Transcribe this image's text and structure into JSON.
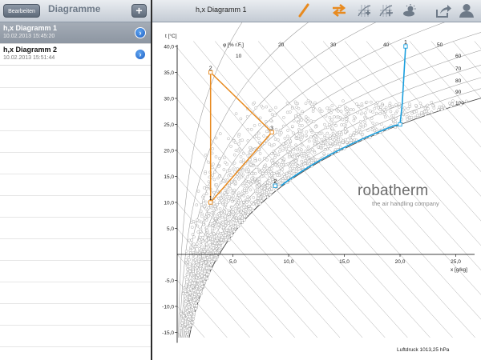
{
  "master": {
    "edit_label": "Bearbeiten",
    "title": "Diagramme",
    "add_label": "+",
    "items": [
      {
        "name": "h,x Diagramm 1",
        "date": "10.02.2013 15:45:20",
        "selected": true
      },
      {
        "name": "h,x Diagramm 2",
        "date": "10.02.2013 15:51:44",
        "selected": false
      }
    ]
  },
  "detail": {
    "title": "h,x Diagramm 1",
    "toolbar_icons": [
      "pencil-icon",
      "swap-arrows-icon",
      "grid-add-icon",
      "grid-move-icon",
      "weather-icon",
      "share-icon",
      "user-icon"
    ],
    "colors": {
      "accent": "#e88a1f",
      "process_blue": "#1a9fde",
      "toolbar_gray": "#6e7a88"
    }
  },
  "chart_data": {
    "type": "scatter",
    "title": "",
    "xlabel": "x [g/kg]",
    "ylabel": "t [°C]",
    "xlim": [
      0,
      26
    ],
    "ylim": [
      -17,
      41
    ],
    "x_ticks": [
      "5,0",
      "10,0",
      "15,0",
      "20,0",
      "25,0"
    ],
    "y_ticks": [
      "40,0",
      "35,0",
      "30,0",
      "25,0",
      "20,0",
      "15,0",
      "10,0",
      "5,0",
      "-5,0",
      "-10,0",
      "-15,0"
    ],
    "rh_axis_label": "φ [% r.F.]",
    "rh_curves": [
      10,
      20,
      30,
      40,
      50,
      60,
      70,
      80,
      90,
      100
    ],
    "series": [
      {
        "name": "",
        "color": "#e88a1f",
        "closed": true,
        "points": [
          {
            "label": "2",
            "x": 3.0,
            "t": 35.0
          },
          {
            "label": "3",
            "x": 8.5,
            "t": 23.5
          },
          {
            "label": "1",
            "x": 3.0,
            "t": 10.0
          }
        ]
      },
      {
        "name": "",
        "color": "#1a9fde",
        "closed": false,
        "points": [
          {
            "label": "2",
            "x": 8.8,
            "t": 13.2
          },
          {
            "label": "",
            "x": 20.0,
            "t": 25.0
          },
          {
            "label": "1",
            "x": 20.5,
            "t": 40.0
          }
        ]
      }
    ],
    "scatter_note": "dense cloud of measurement points"
  },
  "logo": {
    "name": "robatherm",
    "tagline": "the air handling company"
  },
  "footer": {
    "pressure": "Luftdruck 1013,25 hPa"
  }
}
